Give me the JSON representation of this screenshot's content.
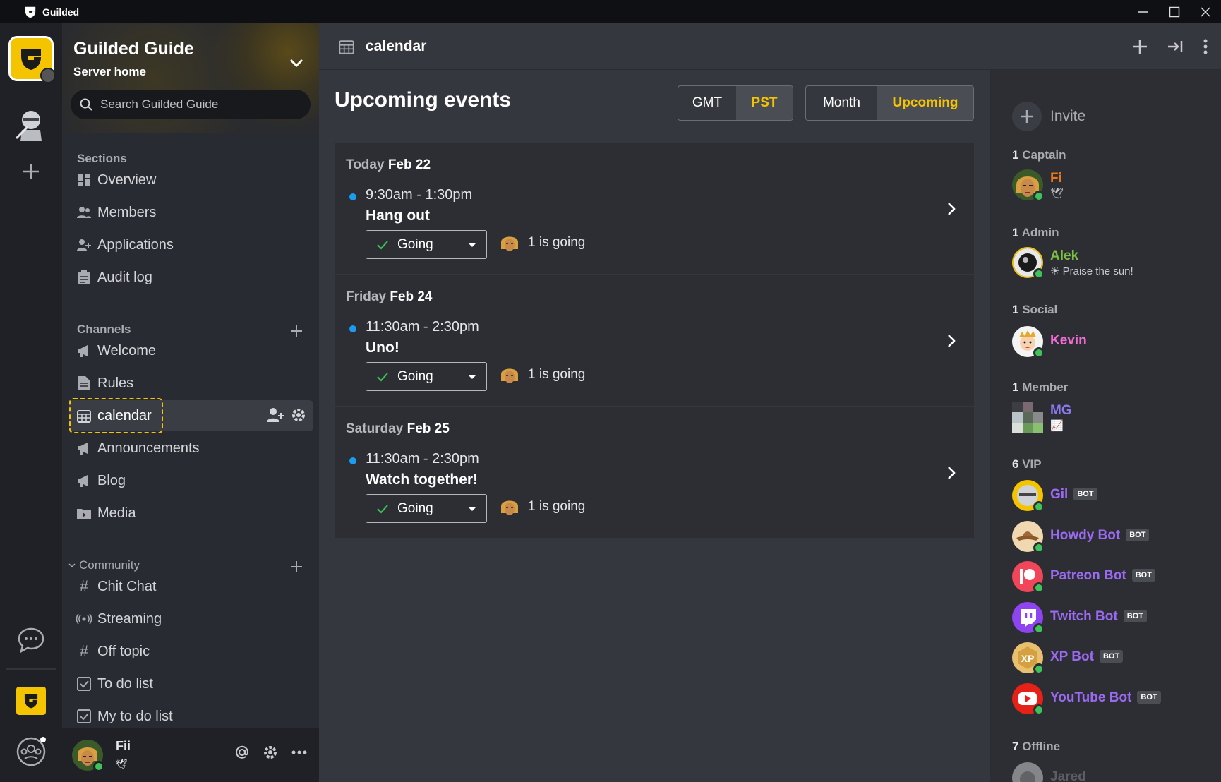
{
  "app": {
    "title": "Guilded"
  },
  "server": {
    "name": "Guilded Guide",
    "subtitle": "Server home",
    "search_placeholder": "Search Guilded Guide"
  },
  "sections": {
    "heading": "Sections",
    "items": [
      {
        "label": "Overview",
        "icon": "overview-icon"
      },
      {
        "label": "Members",
        "icon": "members-icon"
      },
      {
        "label": "Applications",
        "icon": "applications-icon"
      },
      {
        "label": "Audit log",
        "icon": "audit-log-icon"
      }
    ]
  },
  "channels": {
    "heading": "Channels",
    "items": [
      {
        "label": "Welcome",
        "icon": "megaphone-icon"
      },
      {
        "label": "Rules",
        "icon": "doc-icon"
      },
      {
        "label": "calendar",
        "icon": "calendar-icon",
        "active": true
      },
      {
        "label": "Announcements",
        "icon": "megaphone-icon"
      },
      {
        "label": "Blog",
        "icon": "megaphone-icon"
      },
      {
        "label": "Media",
        "icon": "media-icon"
      }
    ]
  },
  "community": {
    "heading": "Community",
    "items": [
      {
        "label": "Chit Chat",
        "icon": "hash-icon"
      },
      {
        "label": "Streaming",
        "icon": "stream-icon"
      },
      {
        "label": "Off topic",
        "icon": "hash-icon"
      },
      {
        "label": "To do list",
        "icon": "checkbox-icon"
      },
      {
        "label": "My to do list",
        "icon": "checkbox-icon"
      }
    ]
  },
  "user": {
    "name": "Fii",
    "status": "🕊"
  },
  "header": {
    "title": "calendar"
  },
  "page": {
    "title": "Upcoming events",
    "timezones": [
      "GMT",
      "PST"
    ],
    "timezone_selected": "PST",
    "views": [
      "Month",
      "Upcoming"
    ],
    "view_selected": "Upcoming"
  },
  "events": [
    {
      "day_prefix": "Today",
      "date": "Feb 22",
      "time": "9:30am - 1:30pm",
      "name": "Hang out",
      "rsvp": "Going",
      "going": "1 is going"
    },
    {
      "day_prefix": "Friday",
      "date": "Feb 24",
      "time": "11:30am - 2:30pm",
      "name": "Uno!",
      "rsvp": "Going",
      "going": "1 is going"
    },
    {
      "day_prefix": "Saturday",
      "date": "Feb 25",
      "time": "11:30am - 2:30pm",
      "name": "Watch together!",
      "rsvp": "Going",
      "going": "1 is going"
    }
  ],
  "members": {
    "invite_label": "Invite",
    "roles": [
      {
        "count": "1",
        "name": "Captain"
      },
      {
        "count": "1",
        "name": "Admin"
      },
      {
        "count": "1",
        "name": "Social"
      },
      {
        "count": "1",
        "name": "Member"
      },
      {
        "count": "6",
        "name": "VIP"
      },
      {
        "count": "7",
        "name": "Offline"
      }
    ],
    "list": [
      {
        "name": "Fi",
        "status": "🕊",
        "color": "#e8761a"
      },
      {
        "name": "Alek",
        "status": "☀ Praise the sun!",
        "color": "#7dbf42"
      },
      {
        "name": "Kevin",
        "status": "",
        "color": "#ee6bd4"
      },
      {
        "name": "MG",
        "status": "📈",
        "color": "#8a7af0"
      },
      {
        "name": "Gil",
        "bot": "BOT",
        "color": "#9b6af2"
      },
      {
        "name": "Howdy Bot",
        "bot": "BOT",
        "color": "#9b6af2"
      },
      {
        "name": "Patreon Bot",
        "bot": "BOT",
        "color": "#9b6af2"
      },
      {
        "name": "Twitch Bot",
        "bot": "BOT",
        "color": "#9b6af2"
      },
      {
        "name": "XP Bot",
        "bot": "BOT",
        "color": "#9b6af2"
      },
      {
        "name": "YouTube Bot",
        "bot": "BOT",
        "color": "#9b6af2"
      },
      {
        "name": "Jared",
        "status": "",
        "color": "#8a8c92"
      }
    ]
  },
  "colors": {
    "accent": "#f5c400",
    "online": "#3ec35b",
    "event_dot": "#1a9cf0"
  }
}
